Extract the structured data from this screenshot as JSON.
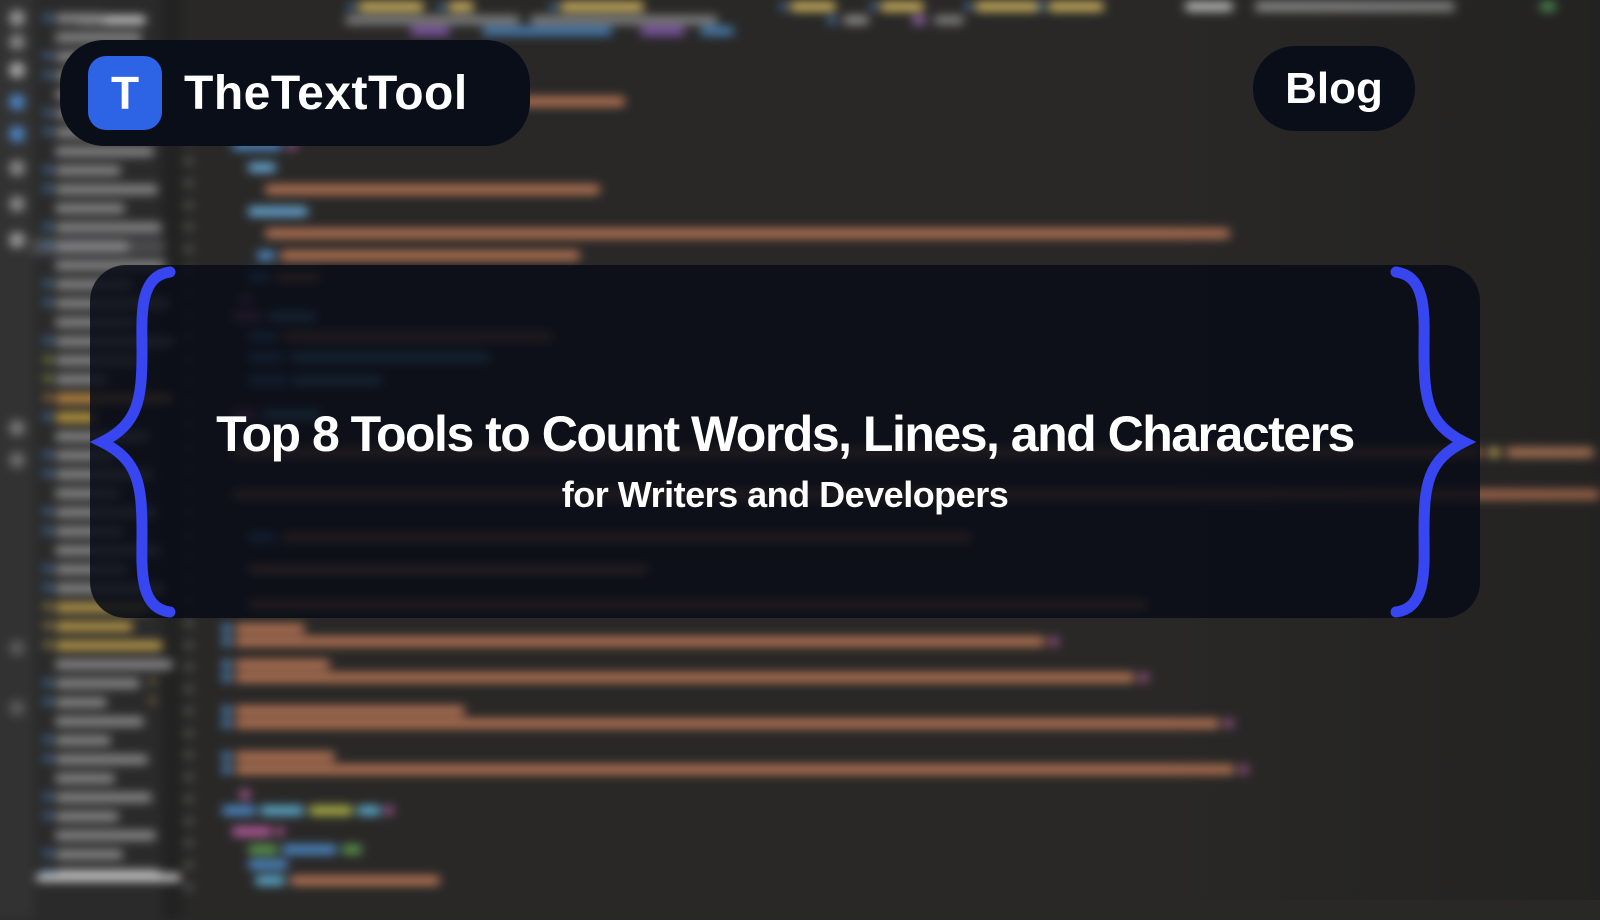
{
  "brand": {
    "name": "TheTextTool",
    "icon_letter": "T"
  },
  "nav": {
    "blog_label": "Blog"
  },
  "hero": {
    "title": "Top 8 Tools to Count Words, Lines, and Characters",
    "subtitle": "for Writers and Developers"
  },
  "colors": {
    "accent_blue": "#3746f0",
    "logo_blue": "#2d64e6",
    "pill_bg": "#0a0e19",
    "card_bg": "rgba(8,12,22,0.85)",
    "text": "#ffffff"
  },
  "background": {
    "description": "blurred dark code editor with file explorer, tabs and syntax highlighted code"
  }
}
